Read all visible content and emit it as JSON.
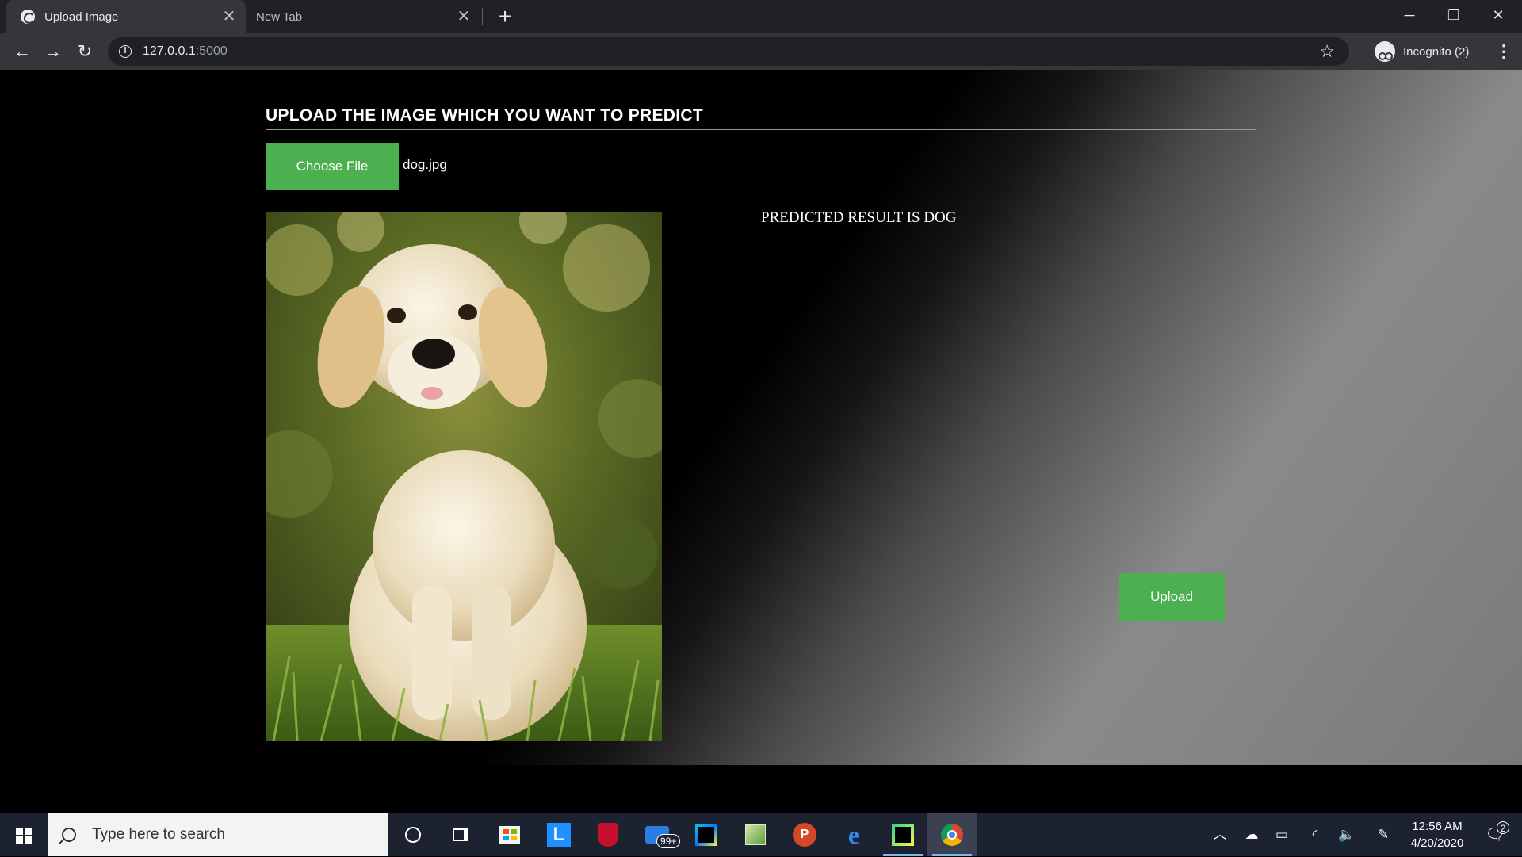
{
  "browser": {
    "tabs": [
      {
        "title": "Upload Image",
        "active": true
      },
      {
        "title": "New Tab",
        "active": false
      }
    ],
    "url": {
      "host": "127.0.0.1",
      "port": ":5000"
    },
    "profile_label": "Incognito (2)"
  },
  "page": {
    "heading": "UPLOAD THE IMAGE WHICH YOU WANT TO PREDICT",
    "choose_file_label": "Choose File",
    "selected_file": "dog.jpg",
    "result_text": "PREDICTED RESULT IS DOG",
    "upload_label": "Upload",
    "accent_color": "#4caf50"
  },
  "taskbar": {
    "search_placeholder": "Type here to search",
    "mail_badge": "99+",
    "time": "12:56 AM",
    "date": "4/20/2020",
    "notification_count": "2",
    "apps": [
      "cortana-icon",
      "task-view-icon",
      "store-icon",
      "l-app-icon",
      "mcafee-icon",
      "mail-icon",
      "webstorm-icon",
      "image-editor-icon",
      "powerpoint-icon",
      "edge-icon",
      "pycharm-icon",
      "chrome-icon"
    ]
  }
}
